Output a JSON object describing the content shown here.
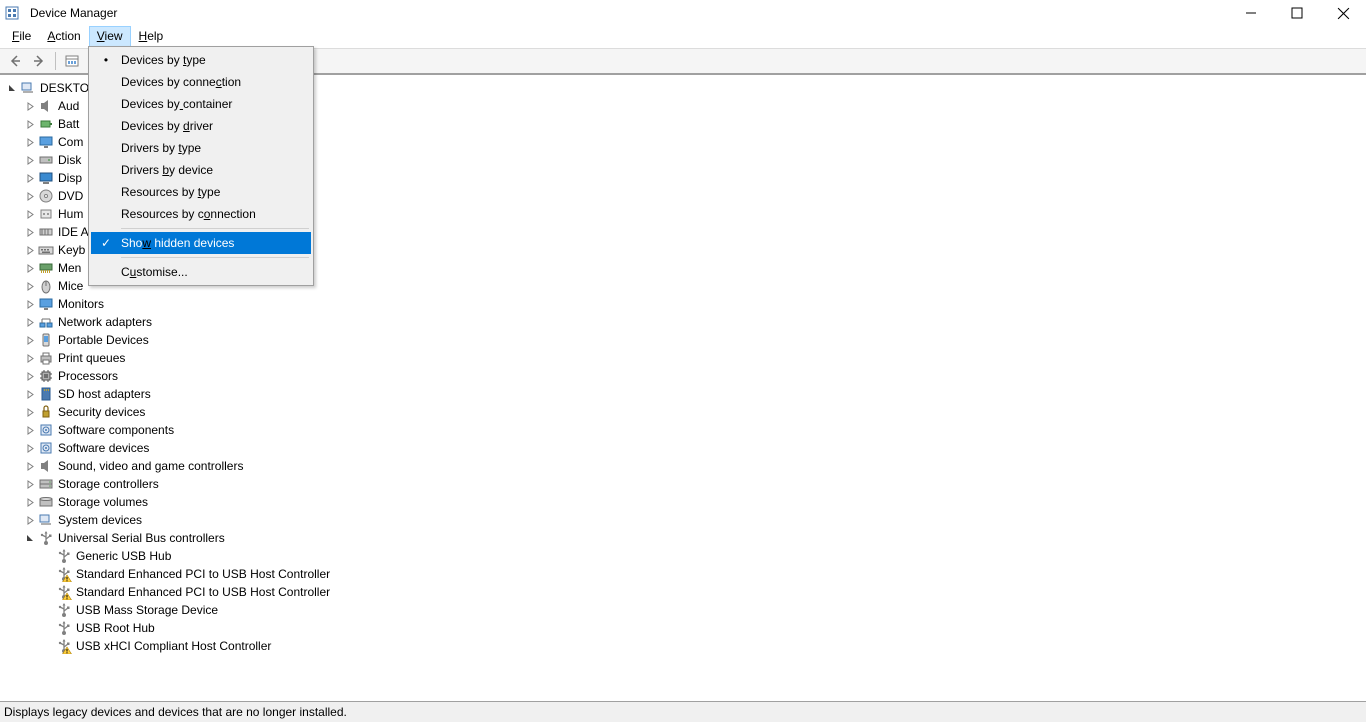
{
  "window": {
    "title": "Device Manager"
  },
  "menubar": {
    "file": "File",
    "action": "Action",
    "view": "View",
    "help": "Help"
  },
  "view_menu": {
    "items": [
      {
        "label": "Devices by type",
        "u": 11,
        "mark": "dot"
      },
      {
        "label": "Devices by connection",
        "u": 16
      },
      {
        "label": "Devices by container",
        "u": 10
      },
      {
        "label": "Devices by driver",
        "u": 11
      },
      {
        "label": "Drivers by type",
        "u": 11
      },
      {
        "label": "Drivers by device",
        "u": 8
      },
      {
        "label": "Resources by type",
        "u": 13
      },
      {
        "label": "Resources by connection",
        "u": 14
      }
    ],
    "show_hidden": {
      "label": "Show hidden devices",
      "u": 3,
      "mark": "check"
    },
    "customise": {
      "label": "Customise...",
      "u": 1
    }
  },
  "tree": {
    "root": "DESKTO",
    "categories": [
      {
        "label": "Aud",
        "icon": "speaker"
      },
      {
        "label": "Batt",
        "icon": "battery"
      },
      {
        "label": "Com",
        "icon": "monitor"
      },
      {
        "label": "Disk",
        "icon": "disk"
      },
      {
        "label": "Disp",
        "icon": "display"
      },
      {
        "label": "DVD",
        "icon": "dvd"
      },
      {
        "label": "Hum",
        "icon": "hid"
      },
      {
        "label": "IDE A",
        "icon": "ide"
      },
      {
        "label": "Keyb",
        "icon": "keyboard"
      },
      {
        "label": "Men",
        "icon": "memory"
      },
      {
        "label": "Mice",
        "icon": "mouse"
      },
      {
        "label": "Monitors",
        "icon": "monitor"
      },
      {
        "label": "Network adapters",
        "icon": "network"
      },
      {
        "label": "Portable Devices",
        "icon": "portable"
      },
      {
        "label": "Print queues",
        "icon": "printer"
      },
      {
        "label": "Processors",
        "icon": "cpu"
      },
      {
        "label": "SD host adapters",
        "icon": "sd"
      },
      {
        "label": "Security devices",
        "icon": "security"
      },
      {
        "label": "Software components",
        "icon": "software"
      },
      {
        "label": "Software devices",
        "icon": "software"
      },
      {
        "label": "Sound, video and game controllers",
        "icon": "speaker"
      },
      {
        "label": "Storage controllers",
        "icon": "storage"
      },
      {
        "label": "Storage volumes",
        "icon": "volume"
      },
      {
        "label": "System devices",
        "icon": "system"
      },
      {
        "label": "Universal Serial Bus controllers",
        "icon": "usb",
        "expanded": true
      }
    ],
    "usb_children": [
      {
        "label": "Generic USB Hub",
        "warn": false
      },
      {
        "label": "Standard Enhanced PCI to USB Host Controller",
        "warn": true
      },
      {
        "label": "Standard Enhanced PCI to USB Host Controller",
        "warn": true
      },
      {
        "label": "USB Mass Storage Device",
        "warn": false
      },
      {
        "label": "USB Root Hub",
        "warn": false
      },
      {
        "label": "USB xHCI Compliant Host Controller",
        "warn": true
      }
    ]
  },
  "statusbar": {
    "text": "Displays legacy devices and devices that are no longer installed."
  }
}
